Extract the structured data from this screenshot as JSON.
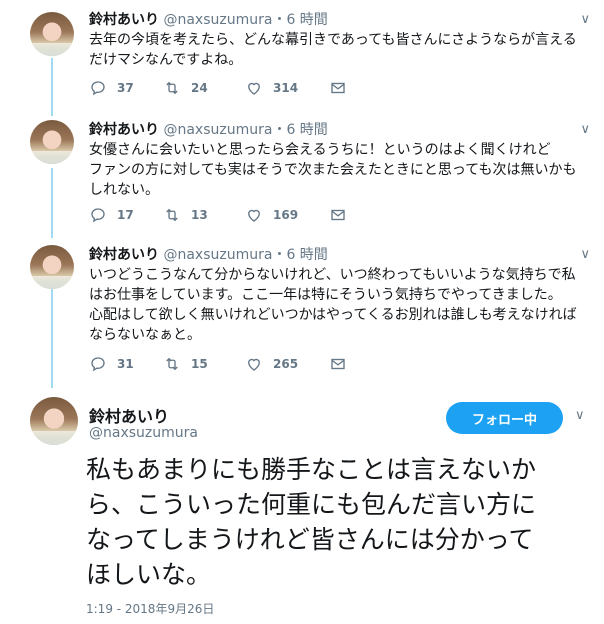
{
  "tweets": [
    {
      "name": "鈴村あいり",
      "handle": "@naxsuzumura",
      "dot": "・",
      "time": "6 時間",
      "text_lines": [
        "去年の今頃を考えたら、どんな幕引きであっても皆さんにさようならが言える",
        "だけマシなんですよね。"
      ],
      "replies": "37",
      "retweets": "24",
      "likes": "314"
    },
    {
      "name": "鈴村あいり",
      "handle": "@naxsuzumura",
      "dot": "・",
      "time": "6 時間",
      "text_lines": [
        "女優さんに会いたいと思ったら会えるうちに！というのはよく聞くけれど",
        "ファンの方に対しても実はそうで次また会えたときにと思っても次は無いかも",
        "しれない。"
      ],
      "replies": "17",
      "retweets": "13",
      "likes": "169"
    },
    {
      "name": "鈴村あいり",
      "handle": "@naxsuzumura",
      "dot": "・",
      "time": "6 時間",
      "text_lines": [
        "いつどうこうなんて分からないけれど、いつ終わってもいいような気持ちで私",
        "はお仕事をしています。ここ一年は特にそういう気持ちでやってきました。",
        "心配はして欲しく無いけれどいつかはやってくるお別れは誰しも考えなければ",
        "ならないなぁと。"
      ],
      "replies": "31",
      "retweets": "15",
      "likes": "265"
    }
  ],
  "main": {
    "name": "鈴村あいり",
    "handle": "@naxsuzumura",
    "follow_label": "フォロー中",
    "text_lines": [
      "私もあまりにも勝手なことは言えないか",
      "ら、こういった何重にも包んだ言い方に",
      "なってしまうけれど皆さんには分かって",
      "ほしいな。"
    ],
    "timestamp": "1:19 - 2018年9月26日"
  },
  "icons": {
    "reply": "reply-icon",
    "retweet": "retweet-icon",
    "like": "heart-icon",
    "dm": "envelope-icon",
    "menu": "chevron-down-icon"
  },
  "colors": {
    "accent": "#1da1f2",
    "thread_line": "#a0d9f2",
    "muted": "#657786"
  }
}
